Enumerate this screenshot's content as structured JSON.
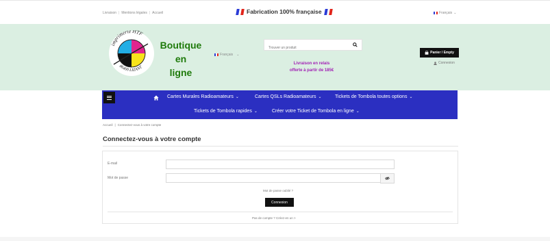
{
  "topbar": {
    "links": [
      "Livraison",
      "Mentions légales",
      "Accueil"
    ],
    "promo": "Fabrication 100% française",
    "language": "Français"
  },
  "header": {
    "logo_text_top": "imprimerie HTF",
    "logo_text_bottom": "86400 LIZANT",
    "brand": [
      "Boutique",
      "en",
      "ligne"
    ],
    "language": "Français",
    "search": {
      "placeholder": "Trouver un produit"
    },
    "delivery": [
      "Livraison en relais",
      "offerte à partir de 185€"
    ],
    "cart_label": "Panier / Empty",
    "login_label": "Connexion"
  },
  "nav": {
    "items_row1": [
      "Cartes Murales Radioamateurs",
      "Cartes QSLs Radioamateurs",
      "Tickets de Tombola toutes options"
    ],
    "items_row2": [
      "Tickets de Tombola rapides",
      "Créer votre Ticket de Tombola en ligne"
    ]
  },
  "breadcrumb": [
    "Accueil",
    "Connectez-vous à votre compte"
  ],
  "page_title": "Connectez-vous à votre compte",
  "form": {
    "email_label": "E-mail",
    "email_value": "",
    "password_label": "Mot de passe",
    "password_value": "",
    "forgot_label": "Mot de passe oublié ?",
    "submit_label": "Connexion",
    "create_label": "Pas de compte ? Créez-en un >"
  },
  "colors": {
    "header_bg": "#dbefe2",
    "nav_bg": "#2b2fc1",
    "brand_green": "#1e7a0a",
    "delivery_purple": "#a11fb4"
  }
}
